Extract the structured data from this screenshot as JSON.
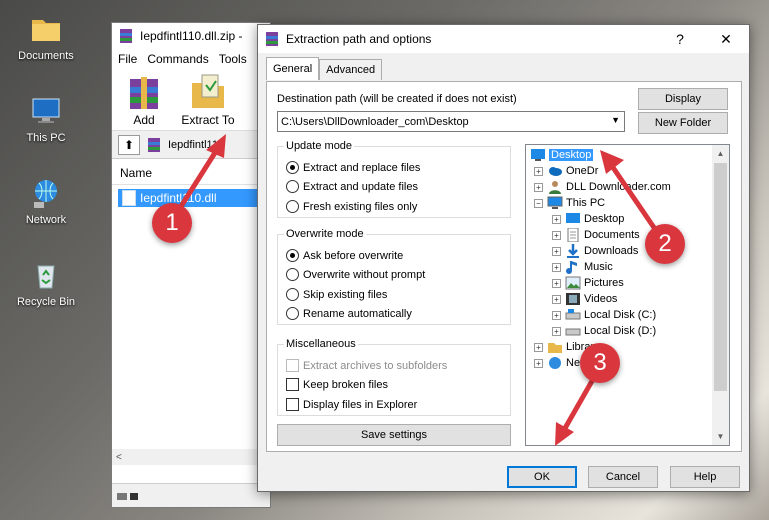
{
  "desktop": {
    "icons": [
      {
        "label": "Documents",
        "icon": "documents-folder-icon"
      },
      {
        "label": "This PC",
        "icon": "computer-icon"
      },
      {
        "label": "Network",
        "icon": "network-icon"
      },
      {
        "label": "Recycle Bin",
        "icon": "recycle-bin-icon"
      }
    ]
  },
  "winrar": {
    "title": "Iepdfintl110.dll.zip -",
    "menu": [
      "File",
      "Commands",
      "Tools"
    ],
    "toolbar": [
      {
        "label": "Add"
      },
      {
        "label": "Extract To"
      }
    ],
    "path": "Iepdfintl110",
    "column_name": "Name",
    "file": "Iepdfintl110.dll",
    "scroll_left": "<"
  },
  "dialog": {
    "title": "Extraction path and options",
    "help": "?",
    "close": "✕",
    "tabs": [
      "General",
      "Advanced"
    ],
    "dest_label": "Destination path (will be created if does not exist)",
    "dest_value": "C:\\Users\\DllDownloader_com\\Desktop",
    "display_btn": "Display",
    "new_folder_btn": "New Folder",
    "update_mode": {
      "title": "Update mode",
      "options": [
        "Extract and replace files",
        "Extract and update files",
        "Fresh existing files only"
      ],
      "selected": 0
    },
    "overwrite_mode": {
      "title": "Overwrite mode",
      "options": [
        "Ask before overwrite",
        "Overwrite without prompt",
        "Skip existing files",
        "Rename automatically"
      ],
      "selected": 0
    },
    "misc": {
      "title": "Miscellaneous",
      "options": [
        "Extract archives to subfolders",
        "Keep broken files",
        "Display files in Explorer"
      ]
    },
    "save_settings": "Save settings",
    "tree": [
      {
        "label": "Desktop",
        "level": 0,
        "selected": true
      },
      {
        "label": "OneDr",
        "level": 1
      },
      {
        "label": "DLL Downloader.com",
        "level": 1
      },
      {
        "label": "This PC",
        "level": 1,
        "expanded": true
      },
      {
        "label": "Desktop",
        "level": 2
      },
      {
        "label": "Documents",
        "level": 2
      },
      {
        "label": "Downloads",
        "level": 2
      },
      {
        "label": "Music",
        "level": 2
      },
      {
        "label": "Pictures",
        "level": 2
      },
      {
        "label": "Videos",
        "level": 2
      },
      {
        "label": "Local Disk (C:)",
        "level": 2
      },
      {
        "label": "Local Disk (D:)",
        "level": 2
      },
      {
        "label": "Librar",
        "level": 1
      },
      {
        "label": "Net",
        "level": 1
      }
    ],
    "ok": "OK",
    "cancel": "Cancel",
    "help_btn": "Help"
  },
  "annotations": [
    "1",
    "2",
    "3"
  ],
  "colors": {
    "marker": "#d9363e",
    "selection": "#3399ff",
    "focus": "#0078d7"
  }
}
